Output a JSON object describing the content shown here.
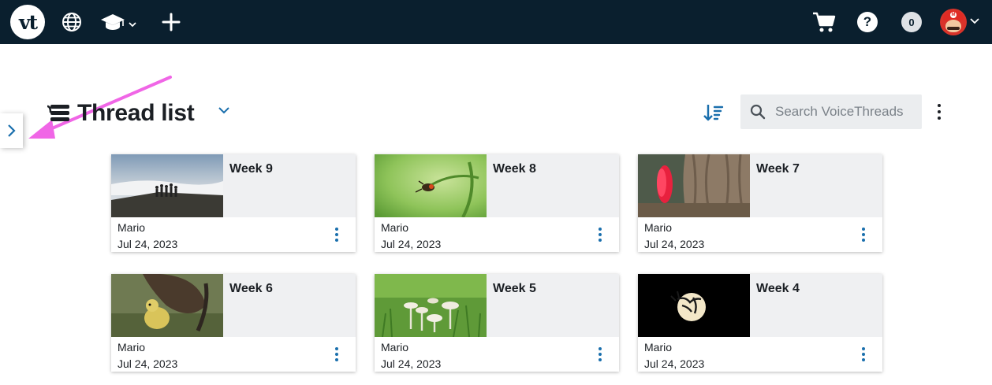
{
  "topbar": {
    "logo_text": "vt",
    "icons": [
      "globe-icon",
      "graduation-cap-icon",
      "plus-icon",
      "cart-icon",
      "help-icon",
      "avatar"
    ],
    "help_text": "?",
    "notification_count": "0"
  },
  "header": {
    "title": "Thread list",
    "search_placeholder": "Search VoiceThreads"
  },
  "colors": {
    "topbar": "#0a1f2e",
    "accent": "#1a6fad",
    "annotation_arrow": "#f066e6"
  },
  "threads": [
    {
      "title": "Week 9",
      "author": "Mario",
      "date": "Jul 24, 2023"
    },
    {
      "title": "Week 8",
      "author": "Mario",
      "date": "Jul 24, 2023"
    },
    {
      "title": "Week 7",
      "author": "Mario",
      "date": "Jul 24, 2023"
    },
    {
      "title": "Week 6",
      "author": "Mario",
      "date": "Jul 24, 2023"
    },
    {
      "title": "Week 5",
      "author": "Mario",
      "date": "Jul 24, 2023"
    },
    {
      "title": "Week 4",
      "author": "Mario",
      "date": "Jul 24, 2023"
    }
  ]
}
